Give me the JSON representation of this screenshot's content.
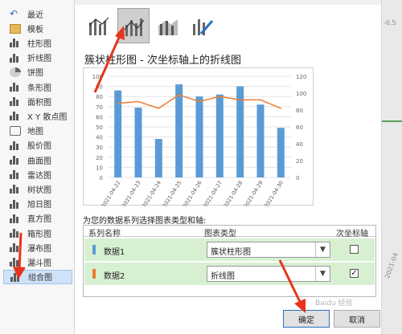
{
  "sidebar": {
    "items": [
      {
        "label": "最近",
        "icon": "recent-icon"
      },
      {
        "label": "模板",
        "icon": "template-folder-icon"
      },
      {
        "label": "柱形图",
        "icon": "column-chart-icon"
      },
      {
        "label": "折线图",
        "icon": "line-chart-icon"
      },
      {
        "label": "饼图",
        "icon": "pie-chart-icon"
      },
      {
        "label": "条形图",
        "icon": "bar-chart-icon"
      },
      {
        "label": "面积图",
        "icon": "area-chart-icon"
      },
      {
        "label": "X Y 散点图",
        "icon": "scatter-chart-icon"
      },
      {
        "label": "地图",
        "icon": "map-chart-icon"
      },
      {
        "label": "股价图",
        "icon": "stock-chart-icon"
      },
      {
        "label": "曲面图",
        "icon": "surface-chart-icon"
      },
      {
        "label": "雷达图",
        "icon": "radar-chart-icon"
      },
      {
        "label": "树状图",
        "icon": "treemap-chart-icon"
      },
      {
        "label": "旭日图",
        "icon": "sunburst-chart-icon"
      },
      {
        "label": "直方图",
        "icon": "histogram-chart-icon"
      },
      {
        "label": "箱形图",
        "icon": "boxplot-chart-icon"
      },
      {
        "label": "瀑布图",
        "icon": "waterfall-chart-icon"
      },
      {
        "label": "漏斗图",
        "icon": "funnel-chart-icon"
      },
      {
        "label": "组合图",
        "icon": "combo-chart-icon"
      }
    ],
    "selected": "组合图"
  },
  "combo_types": [
    {
      "icon": "clustered-column-line-icon",
      "selected": false
    },
    {
      "icon": "clustered-column-line-secondary-axis-icon",
      "selected": true
    },
    {
      "icon": "stacked-area-clustered-column-icon",
      "selected": false
    },
    {
      "icon": "custom-combination-icon",
      "selected": false
    }
  ],
  "main": {
    "chart_title": "簇状柱形图 - 次坐标轴上的折线图",
    "series_prompt": "为您的数据系列选择图表类型和轴:",
    "table_headers": {
      "series_name": "系列名称",
      "chart_type": "图表类型",
      "secondary_axis": "次坐标轴"
    },
    "series": [
      {
        "name": "数据1",
        "chart_type": "簇状柱形图",
        "secondary_axis": "",
        "color": "#5b9bd5"
      },
      {
        "name": "数据2",
        "chart_type": "折线图",
        "secondary_axis": "✓",
        "color": "#ed7d31"
      }
    ]
  },
  "footer": {
    "ok_label": "确定",
    "cancel_label": "取消"
  },
  "watermark": "Baidu 经验",
  "chart_data": {
    "type": "bar",
    "categories": [
      "2021-04-22",
      "2021-04-23",
      "2021-04-24",
      "2021-04-25",
      "2021-04-26",
      "2021-04-27",
      "2021-04-28",
      "2021-04-29",
      "2021-04-30"
    ],
    "series": [
      {
        "values": [
          86,
          69,
          38,
          92,
          80,
          82,
          90,
          72,
          49
        ],
        "type": "bar",
        "axis": "primary",
        "color": "#5b9bd5"
      },
      {
        "values": [
          88,
          90,
          82,
          98,
          90,
          96,
          92,
          92,
          82
        ],
        "type": "line",
        "axis": "secondary",
        "color": "#ed7d31"
      }
    ],
    "y_ticks": [
      "0",
      "10",
      "20",
      "30",
      "40",
      "50",
      "60",
      "70",
      "80",
      "90",
      "100"
    ],
    "y2_ticks": [
      "0",
      "20",
      "40",
      "60",
      "80",
      "100",
      "120"
    ],
    "ylim": [
      0,
      100
    ],
    "y2lim": [
      0,
      120
    ],
    "title": "",
    "xlabel": "",
    "ylabel": ""
  },
  "right_strip": {
    "texts": [
      "-0.5",
      "2021-04"
    ]
  },
  "colors": {
    "accent": "#2a70c2",
    "row_bg": "#d8f0d2",
    "bar": "#5b9bd5",
    "line": "#ed7d31",
    "annotation_arrow": "#e8341c"
  }
}
